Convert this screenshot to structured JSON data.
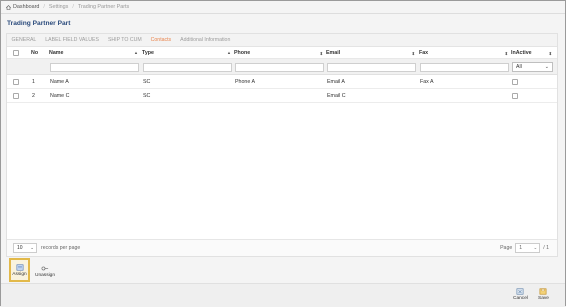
{
  "breadcrumb": {
    "home": "Dashboard",
    "items": [
      "Settings",
      "Trading Partner Parts"
    ]
  },
  "page_title": "Trading Partner Part",
  "tabs": [
    {
      "label": "GENERAL",
      "active": false
    },
    {
      "label": "LABEL FIELD VALUES",
      "active": false
    },
    {
      "label": "SHIP TO CUM",
      "active": false
    },
    {
      "label": "Contacts",
      "active": true
    },
    {
      "label": "Additional Information",
      "active": false
    }
  ],
  "columns": {
    "no": "No",
    "name": "Name",
    "type": "Type",
    "phone": "Phone",
    "email": "Email",
    "fax": "Fax",
    "inactive": "InActive"
  },
  "filter": {
    "inactive_value": "All"
  },
  "rows": [
    {
      "no": "1",
      "name": "Name A",
      "type": "SC",
      "phone": "Phone A",
      "email": "Email A",
      "fax": "Fax A"
    },
    {
      "no": "2",
      "name": "Name C",
      "type": "SC",
      "phone": "",
      "email": "Email C",
      "fax": ""
    }
  ],
  "footer": {
    "per_page_value": "10",
    "per_page_label": "records per page",
    "page_label": "Page",
    "page_value": "1",
    "page_total": "/ 1"
  },
  "actions": {
    "assign": "Assign",
    "unassign": "Unassign"
  },
  "bottom": {
    "cancel": "Cancel",
    "save": "Save"
  },
  "colors": {
    "accent_tab": "#e9834b",
    "title": "#2b4b7c",
    "highlight": "#e2b94a"
  }
}
